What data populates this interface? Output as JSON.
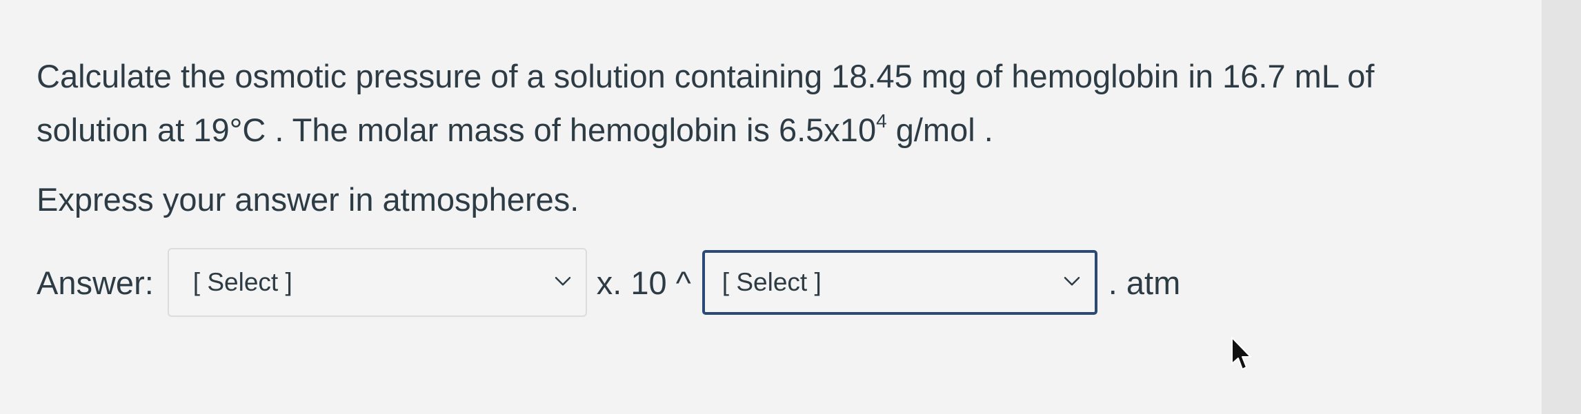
{
  "question": {
    "line1": "Calculate the osmotic pressure of a solution containing 18.45 mg of hemoglobin in 16.7 mL of",
    "line2_pre": "solution at 19",
    "line2_degree": "°C",
    "line2_mid": " . The molar mass of hemoglobin is  6.5x10",
    "line2_exp": "4",
    "line2_post": " g/mol ."
  },
  "instruction": "Express your answer in atmospheres.",
  "answer": {
    "label": "Answer:",
    "select1_value": "[ Select ]",
    "multiplier": "x. 10 ^",
    "select2_value": "[ Select ]",
    "unit": ". atm"
  },
  "icons": {
    "dropdown": "chevron-down-icon",
    "cursor": "mouse-pointer-icon"
  },
  "colors": {
    "text": "#2d3b45",
    "focus_border": "#2b4a73",
    "select_border": "#dcdcdc",
    "background": "#f3f3f3"
  }
}
